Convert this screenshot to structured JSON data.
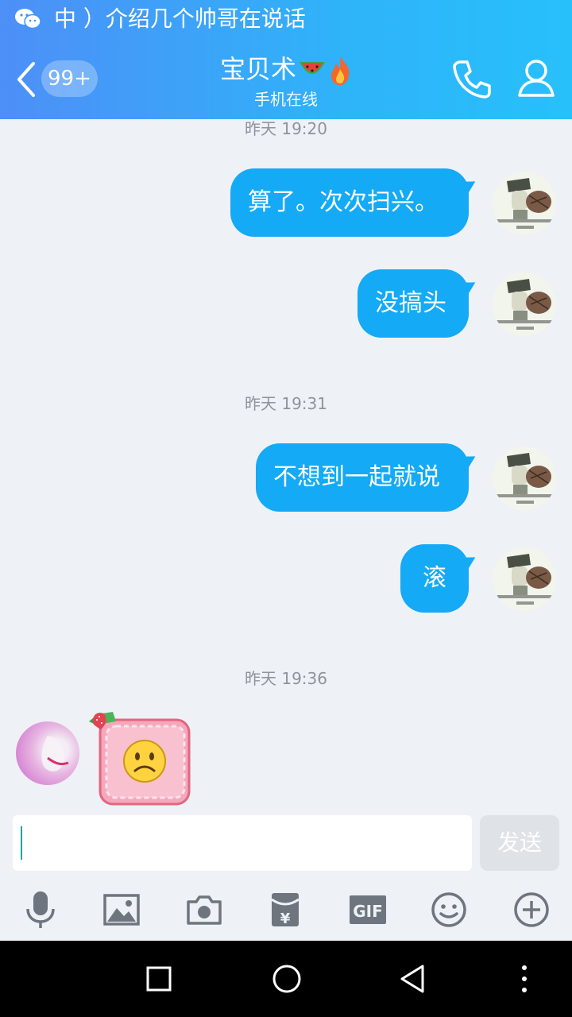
{
  "status_bar": {
    "notification_text": "中 ）介绍几个帅哥在说话"
  },
  "nav": {
    "unread_badge": "99+",
    "title": "宝贝术",
    "title_icons": [
      "watermelon-icon",
      "flame-icon"
    ],
    "subtitle": "手机在线"
  },
  "messages": [
    {
      "type": "timestamp",
      "text": "昨天 19:20"
    },
    {
      "type": "sent",
      "text": "算了。次次扫兴。"
    },
    {
      "type": "sent",
      "text": "没搞头"
    },
    {
      "type": "timestamp",
      "text": "昨天 19:31"
    },
    {
      "type": "sent",
      "text": "不想到一起就说"
    },
    {
      "type": "sent",
      "text": "滚"
    },
    {
      "type": "timestamp",
      "text": "昨天 19:36"
    },
    {
      "type": "received_sticker",
      "sticker": "sad-face-sticker"
    }
  ],
  "input": {
    "value": "",
    "send_label": "发送"
  },
  "toolbar": [
    "microphone-icon",
    "image-icon",
    "camera-icon",
    "red-packet-icon",
    "gif-icon",
    "emoji-icon",
    "plus-icon"
  ],
  "colors": {
    "header_start": "#4d8ff7",
    "header_end": "#27c0fb",
    "bubble": "#14aaf5",
    "background": "#eef1f6",
    "timestamp_text": "#8d949c"
  }
}
